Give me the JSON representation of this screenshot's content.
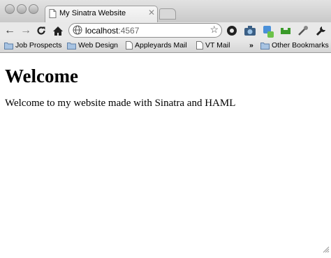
{
  "tab": {
    "title": "My Sinatra Website"
  },
  "omnibox": {
    "host": "localhost",
    "port": ":4567"
  },
  "bookmarks": {
    "items": [
      {
        "label": "Job Prospects",
        "icon": "folder-icon"
      },
      {
        "label": "Web Design",
        "icon": "folder-icon"
      },
      {
        "label": "Appleyards Mail",
        "icon": "page-icon"
      },
      {
        "label": "VT Mail",
        "icon": "page-icon"
      }
    ],
    "overflow": "»",
    "other": "Other Bookmarks"
  },
  "page": {
    "heading": "Welcome",
    "message": "Welcome to my website made with Sinatra and HAML"
  },
  "colors": {
    "chrome": "#e9e9e9",
    "border": "#9a9a9a",
    "page_bg": "#ffffff"
  }
}
